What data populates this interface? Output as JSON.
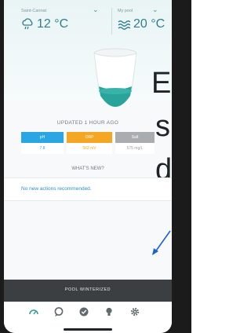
{
  "weather": {
    "left_label": "Saint-Cannat",
    "left_temp": "12 °C",
    "right_label": "My pool",
    "right_temp": "20 °C"
  },
  "overlay_text": [
    "E",
    "s",
    "d"
  ],
  "updated": "UPDATED 1 HOUR AGO",
  "measures": [
    {
      "label": "pH",
      "value": "7.8",
      "color": "#29a6e3",
      "value_color": "#29a6e3"
    },
    {
      "label": "ORP",
      "value": "563 mV",
      "color": "#f5a623",
      "value_color": "#f5a623"
    },
    {
      "label": "Salt",
      "value": "575 mg/L",
      "color": "#a9adb0",
      "value_color": "#9aa1a4"
    }
  ],
  "whats_new": "WHAT'S NEW?",
  "news_text": "No new actions recommended.",
  "pool_status": "POOL WINTERIZED",
  "nav": [
    "gauge-icon",
    "chat-icon",
    "check-icon",
    "bulb-icon",
    "gear-icon"
  ],
  "colors": {
    "accent": "#2f7f8b",
    "news": "#2f8ec2",
    "status_bar": "#3b3f42"
  }
}
